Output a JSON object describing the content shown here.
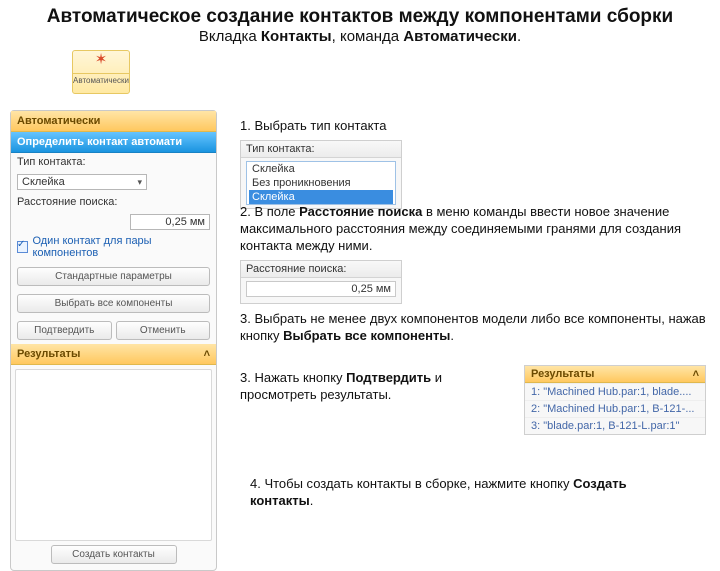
{
  "title": "Автоматическое создание контактов между компонентами сборки",
  "subtitle_pre": "Вкладка ",
  "subtitle_b1": "Контакты",
  "subtitle_mid": ", команда ",
  "subtitle_b2": "Автоматически",
  "subtitle_post": ".",
  "ribbon": {
    "label": "Автоматически"
  },
  "panel": {
    "tab_auto": "Автоматически",
    "head_blue": "Определить контакт автомати",
    "type_label": "Тип контакта:",
    "type_value": "Склейка",
    "dist_label": "Расстояние поиска:",
    "dist_value": "0,25 мм",
    "chk": "Один контакт для пары компонентов",
    "btn_std": "Стандартные параметры",
    "btn_sel_all": "Выбрать все компоненты",
    "btn_ok": "Подтвердить",
    "btn_cancel": "Отменить",
    "res_head": "Результаты",
    "btn_create": "Создать контакты"
  },
  "s1": {
    "n": "1.",
    "t": " Выбрать тип контакта"
  },
  "mini1": {
    "hdr": "Тип контакта:",
    "val": "Склейка",
    "opt1": "Без проникновения",
    "opt2": "Склейка"
  },
  "s2": {
    "n": "2.",
    "pre": " В поле ",
    "b": "Расстояние поиска",
    "post": " в меню команды ввести новое значение максимального расстояния между соединяемыми гранями для создания контакта между ними."
  },
  "mini2": {
    "hdr": "Расстояние поиска:",
    "val": "0,25 мм"
  },
  "s3": {
    "n": "3.",
    "pre": " Выбрать не менее двух компонентов модели либо все компоненты, нажав кнопку ",
    "b": "Выбрать все компоненты",
    "post": "."
  },
  "s4": {
    "n": "3.",
    "pre": " Нажать кнопку ",
    "b": "Подтвердить",
    "post": " и просмотреть результаты."
  },
  "mini3": {
    "hdr": "Результаты",
    "r1": "1: \"Machined Hub.par:1, blade....",
    "r2": "2: \"Machined Hub.par:1, B-121-...",
    "r3": "3: \"blade.par:1, B-121-L.par:1\""
  },
  "s5": {
    "n": "4.",
    "pre": " Чтобы создать контакты в сборке, нажмите кнопку ",
    "b": "Создать контакты",
    "post": "."
  }
}
